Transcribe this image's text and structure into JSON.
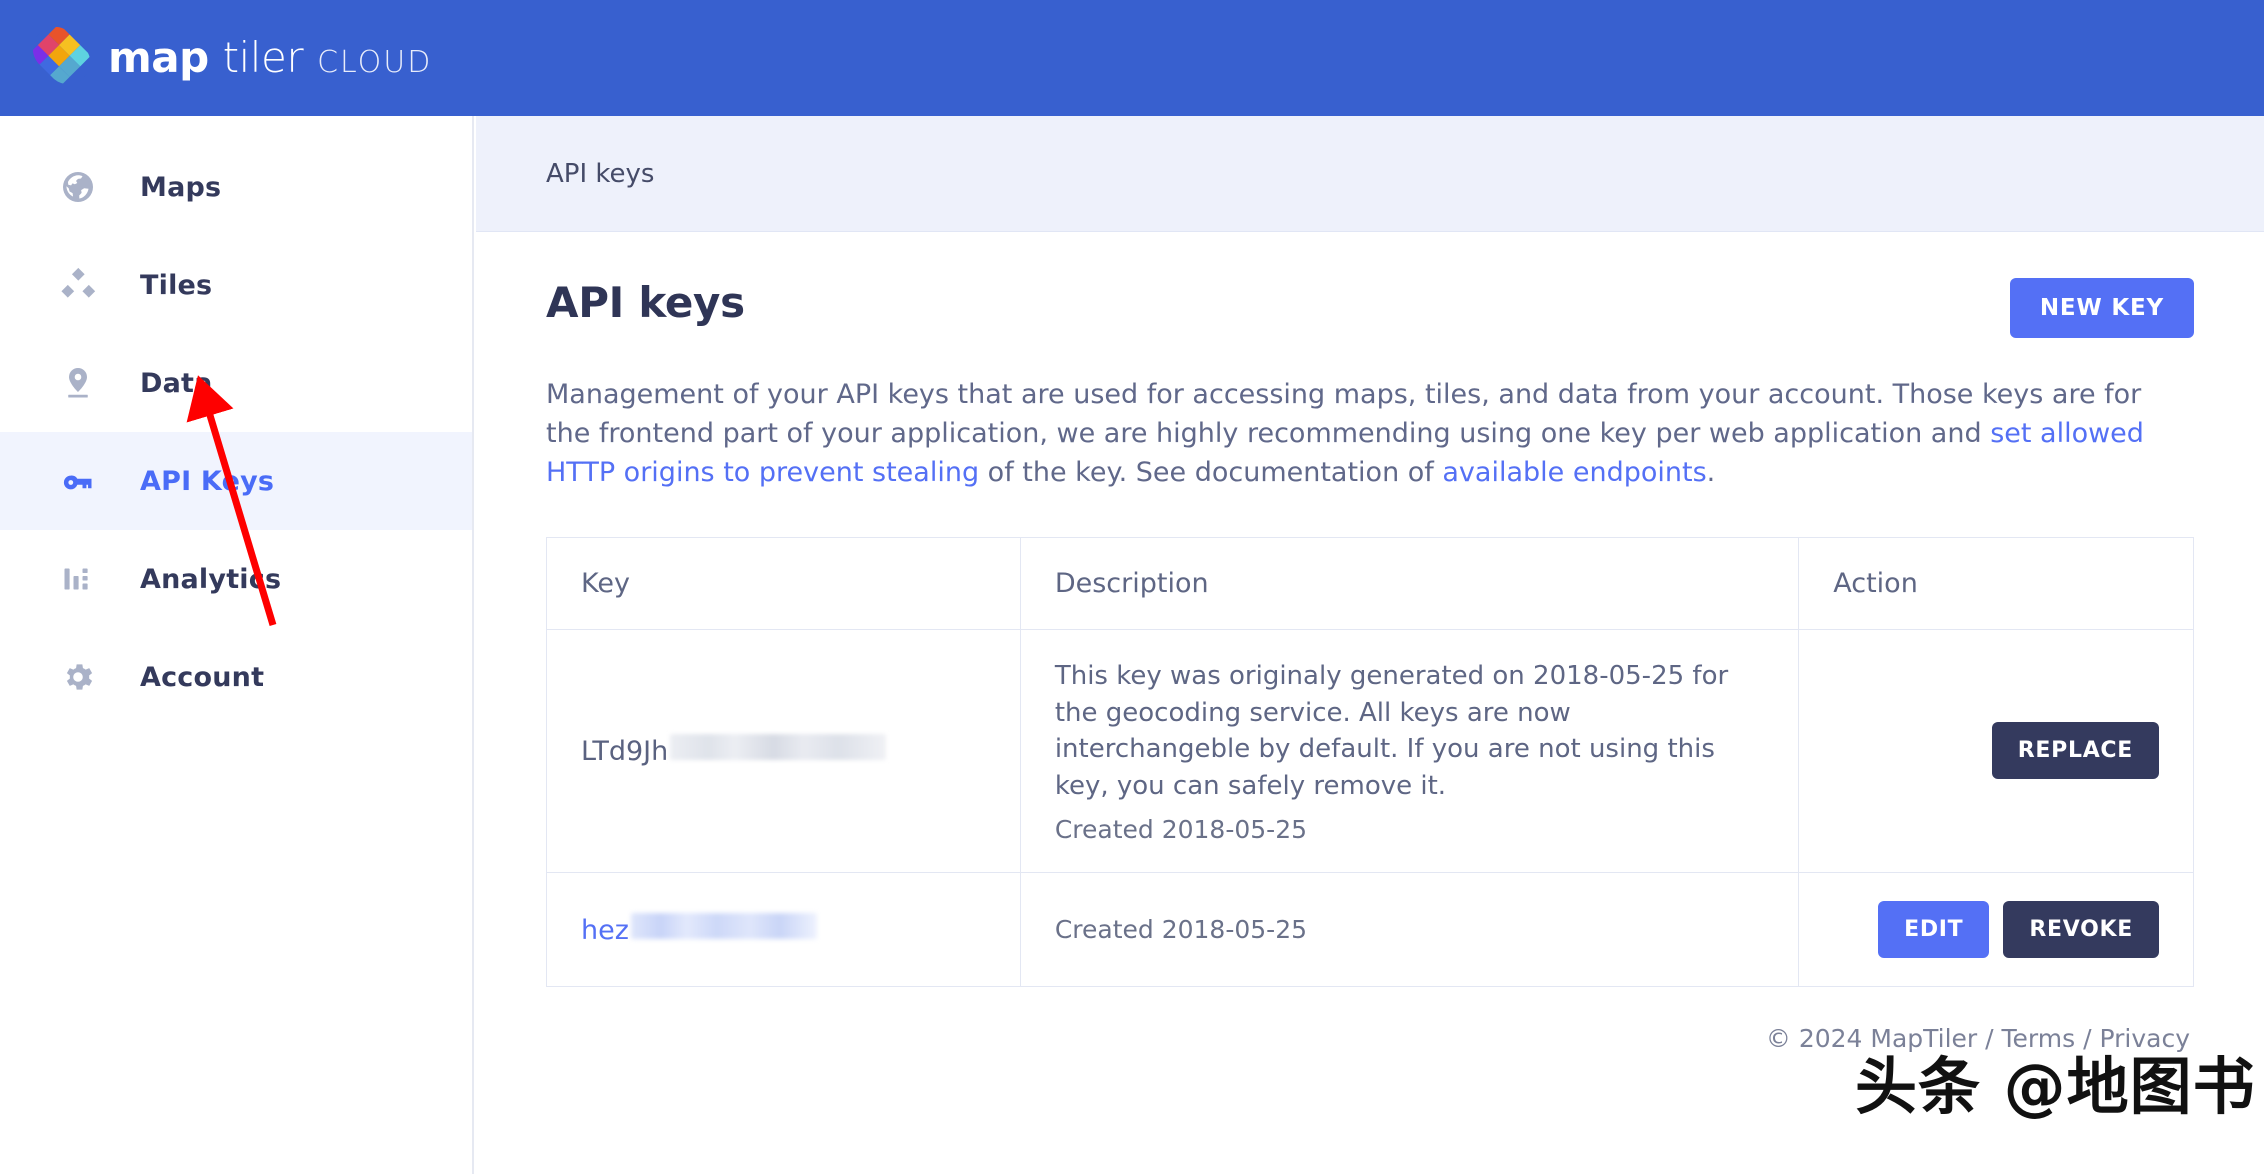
{
  "brand": {
    "word_map": "map",
    "word_tiler": "tiler",
    "word_cloud": "CLOUD",
    "logo_icon": "maptiler-diamond-logo",
    "bar_color": "#3860cf"
  },
  "sidebar": {
    "items": [
      {
        "label": "Maps",
        "icon": "globe-icon",
        "active": false
      },
      {
        "label": "Tiles",
        "icon": "tiles-icon",
        "active": false
      },
      {
        "label": "Data",
        "icon": "map-pin-icon",
        "active": false
      },
      {
        "label": "API Keys",
        "icon": "key-icon",
        "active": true
      },
      {
        "label": "Analytics",
        "icon": "bar-chart-icon",
        "active": false
      },
      {
        "label": "Account",
        "icon": "gear-icon",
        "active": false
      }
    ],
    "active_bg": "#f1f4fe",
    "active_color": "#4a6cf7"
  },
  "breadcrumb": {
    "text": "API keys"
  },
  "page": {
    "title": "API keys",
    "new_key_label": "NEW KEY",
    "new_key_color": "#5470f5",
    "intro": {
      "part1": "Management of your API keys that are used for accessing maps, tiles, and data from your account. Those keys are for the frontend part of your application, we are highly recommending using one key per web application and ",
      "link1": "set allowed HTTP origins to prevent stealing",
      "part2": " of the key. See documentation of ",
      "link2": "available endpoints",
      "part3": ".",
      "link_color": "#5470f5"
    }
  },
  "table": {
    "headers": {
      "key": "Key",
      "description": "Description",
      "action": "Action"
    },
    "rows": [
      {
        "key_visible": "LTd9Jh",
        "key_masked": true,
        "key_is_link": false,
        "description": "This key was originaly generated on 2018-05-25 for the geocoding service. All keys are now interchangeble by default. If you are not using this key, you can safely remove it.",
        "created": "Created 2018-05-25",
        "buttons": [
          {
            "label": "REPLACE",
            "style": "dark",
            "color": "#343a5e"
          }
        ]
      },
      {
        "key_visible": "hez",
        "key_masked": true,
        "key_is_link": true,
        "description": "",
        "created": "Created 2018-05-25",
        "buttons": [
          {
            "label": "EDIT",
            "style": "blue",
            "color": "#5470f5"
          },
          {
            "label": "REVOKE",
            "style": "dark",
            "color": "#343a5e"
          }
        ]
      }
    ]
  },
  "footer": {
    "copyright": "© 2024 MapTiler",
    "sep1": " / ",
    "terms": "Terms",
    "sep2": " / ",
    "privacy": "Privacy"
  },
  "watermark": {
    "text": "头条 @地图书"
  },
  "annotation": {
    "type": "red-arrow",
    "color": "#fe0000",
    "points_to": "API Keys sidebar item"
  }
}
